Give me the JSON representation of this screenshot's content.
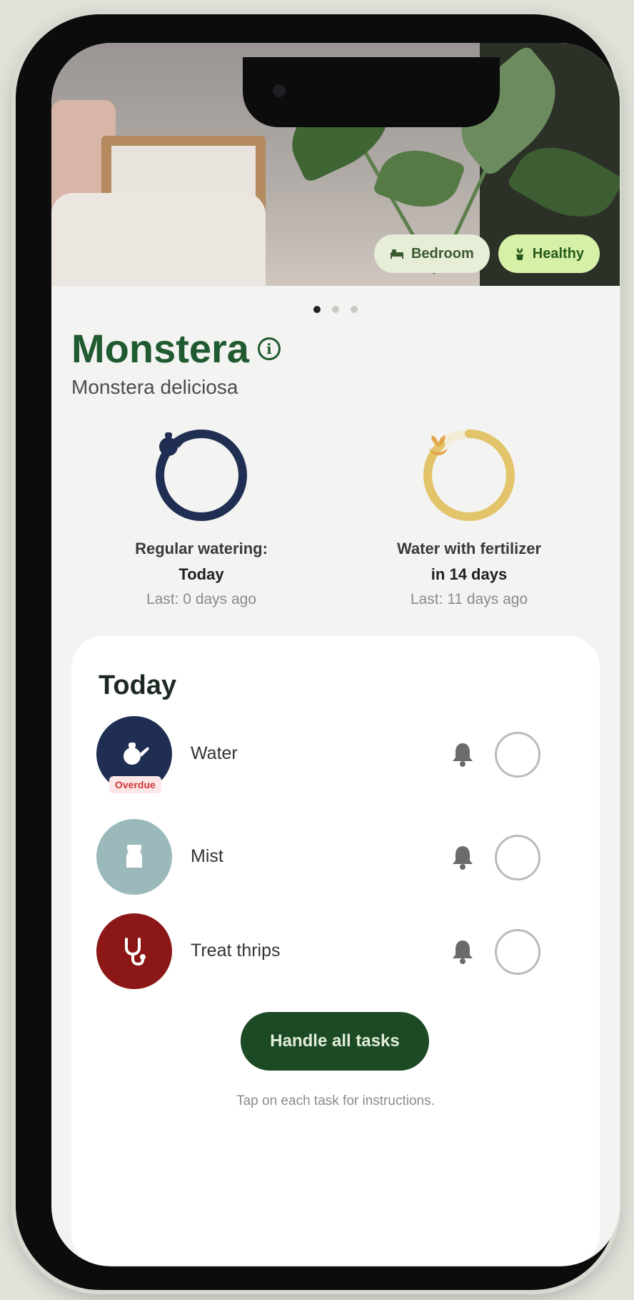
{
  "hero": {
    "location_chip": "Bedroom",
    "health_chip": "Healthy",
    "carousel": {
      "count": 3,
      "active": 0
    }
  },
  "plant": {
    "name": "Monstera",
    "latin_name": "Monstera deliciosa"
  },
  "care": [
    {
      "label": "Regular watering:",
      "when": "Today",
      "last": "Last: 0 days ago",
      "progress": 1.0,
      "color": "#1f2e52",
      "icon": "watering-can-icon"
    },
    {
      "label": "Water with fertilizer",
      "when": "in 14 days",
      "last": "Last: 11 days ago",
      "progress": 0.88,
      "color": "#e3c46a",
      "icon": "sprout-icon"
    }
  ],
  "today": {
    "title": "Today",
    "tasks": [
      {
        "name": "Water",
        "badge": "Overdue",
        "color": "#1f2e52",
        "icon": "watering-can-icon"
      },
      {
        "name": "Mist",
        "color": "#9bb9bb",
        "icon": "mist-bottle-icon"
      },
      {
        "name": "Treat thrips",
        "color": "#8c1717",
        "icon": "stethoscope-icon"
      }
    ],
    "button_label": "Handle all tasks",
    "hint": "Tap on each task for instructions."
  }
}
